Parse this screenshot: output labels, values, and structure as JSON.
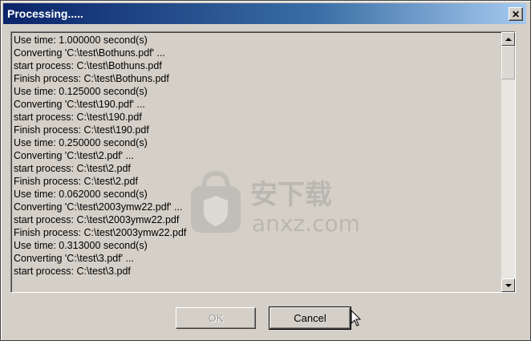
{
  "window": {
    "title": "Processing.....",
    "close_glyph": "✕"
  },
  "log": {
    "lines": [
      "Use time: 1.000000 second(s)",
      "Converting 'C:\\test\\Bothuns.pdf' ...",
      "start process: C:\\test\\Bothuns.pdf",
      "Finish process: C:\\test\\Bothuns.pdf",
      "Use time: 0.125000 second(s)",
      "Converting 'C:\\test\\190.pdf' ...",
      "start process: C:\\test\\190.pdf",
      "Finish process: C:\\test\\190.pdf",
      "Use time: 0.250000 second(s)",
      "Converting 'C:\\test\\2.pdf' ...",
      "start process: C:\\test\\2.pdf",
      "Finish process: C:\\test\\2.pdf",
      "Use time: 0.062000 second(s)",
      "Converting 'C:\\test\\2003ymw22.pdf' ...",
      "start process: C:\\test\\2003ymw22.pdf",
      "Finish process: C:\\test\\2003ymw22.pdf",
      "Use time: 0.313000 second(s)",
      "Converting 'C:\\test\\3.pdf' ...",
      "start process: C:\\test\\3.pdf"
    ]
  },
  "watermark": {
    "text_cn": "安下载",
    "text_en": "anxz.com"
  },
  "buttons": {
    "ok_label": "OK",
    "ok_enabled": false,
    "cancel_label": "Cancel"
  },
  "colors": {
    "title_gradient_start": "#0a246a",
    "title_gradient_end": "#a6caf0",
    "face": "#d4d0c8"
  }
}
